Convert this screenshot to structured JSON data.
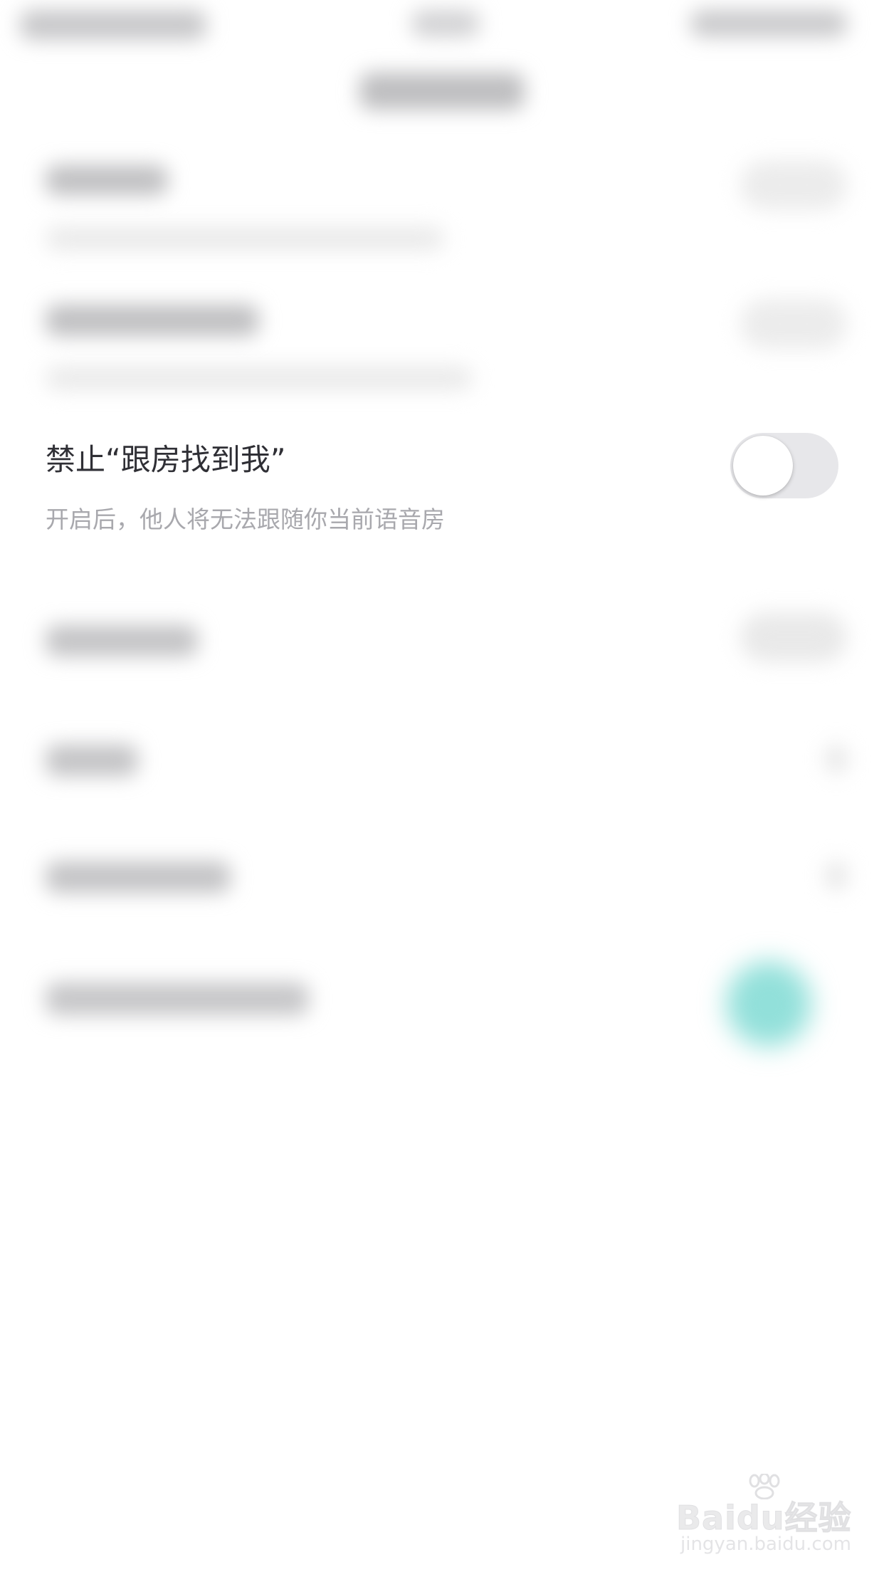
{
  "setting": {
    "title": "禁止“跟房找到我”",
    "description": "开启后，他人将无法跟随你当前语音房",
    "toggle_on": false
  },
  "watermark": {
    "brand": "Baidu经验",
    "url": "jingyan.baidu.com"
  },
  "colors": {
    "background": "#ffffff",
    "title_text": "#2f2f35",
    "description_text": "#a8a8ad",
    "toggle_track_off": "#e7e7ea",
    "accent_teal": "#92e0da"
  }
}
